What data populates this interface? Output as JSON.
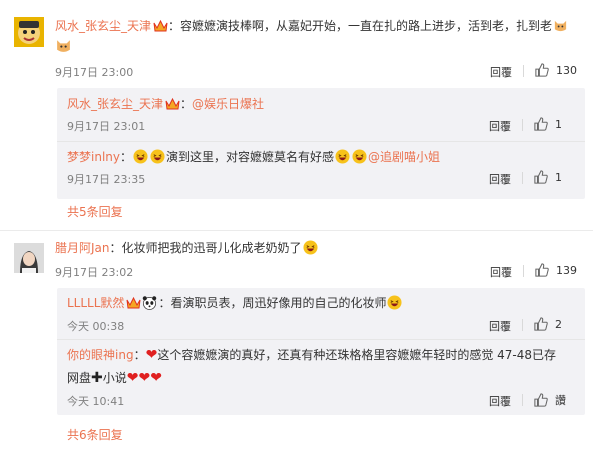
{
  "comments": [
    {
      "user": "风水_张玄尘_天津",
      "text": "：容嬷嬷演技棒啊，从嘉妃开始，一直在扎的路上进步，活到老，扎到老",
      "time": "9月17日 23:00",
      "reply_label": "回覆",
      "likes": "130",
      "replies": [
        {
          "user": "风水_张玄尘_天津",
          "text": "：",
          "mention": "@娱乐日爆社",
          "time": "9月17日 23:01",
          "reply_label": "回覆",
          "likes": "1"
        },
        {
          "user": "梦梦inlny",
          "text_a": "：",
          "text_b": "演到这里，对容嬷嬷莫名有好感",
          "mention": "@追剧喵小姐",
          "time": "9月17日 23:35",
          "reply_label": "回覆",
          "likes": "1"
        }
      ],
      "more_label": "共5条回复"
    },
    {
      "user": "腊月阿Jan",
      "text": "：化妆师把我的迅哥儿化成老奶奶了",
      "time": "9月17日 23:02",
      "reply_label": "回覆",
      "likes": "139",
      "replies": [
        {
          "user": "LLLLL默然",
          "text": "：看演职员表，周迅好像用的自己的化妆师",
          "time": "今天 00:38",
          "reply_label": "回覆",
          "likes": "2"
        },
        {
          "user": "你的眼神ing",
          "text_a": "：",
          "text_b": "这个容嬷嬷演的真好，还真有种还珠格格里容嬷嬷年轻时的感觉 47-48已存",
          "text_c": "网盘",
          "text_d": "小说",
          "time": "今天 10:41",
          "reply_label": "回覆",
          "likes": "讚"
        }
      ],
      "more_label": "共6条回复"
    }
  ],
  "icons": {
    "like": "thumbs-up-icon",
    "vip": "vip-crown-badge-icon",
    "laugh": "laughing-emoji-icon",
    "cat": "cat-emoji-icon",
    "panda": "panda-emoji-icon",
    "heart": "red-heart-emoji",
    "plus": "heavy-plus-emoji"
  },
  "colors": {
    "username": "#eb7350",
    "reply_bg": "#f2f2f5",
    "time": "#808080",
    "text": "#333333"
  }
}
